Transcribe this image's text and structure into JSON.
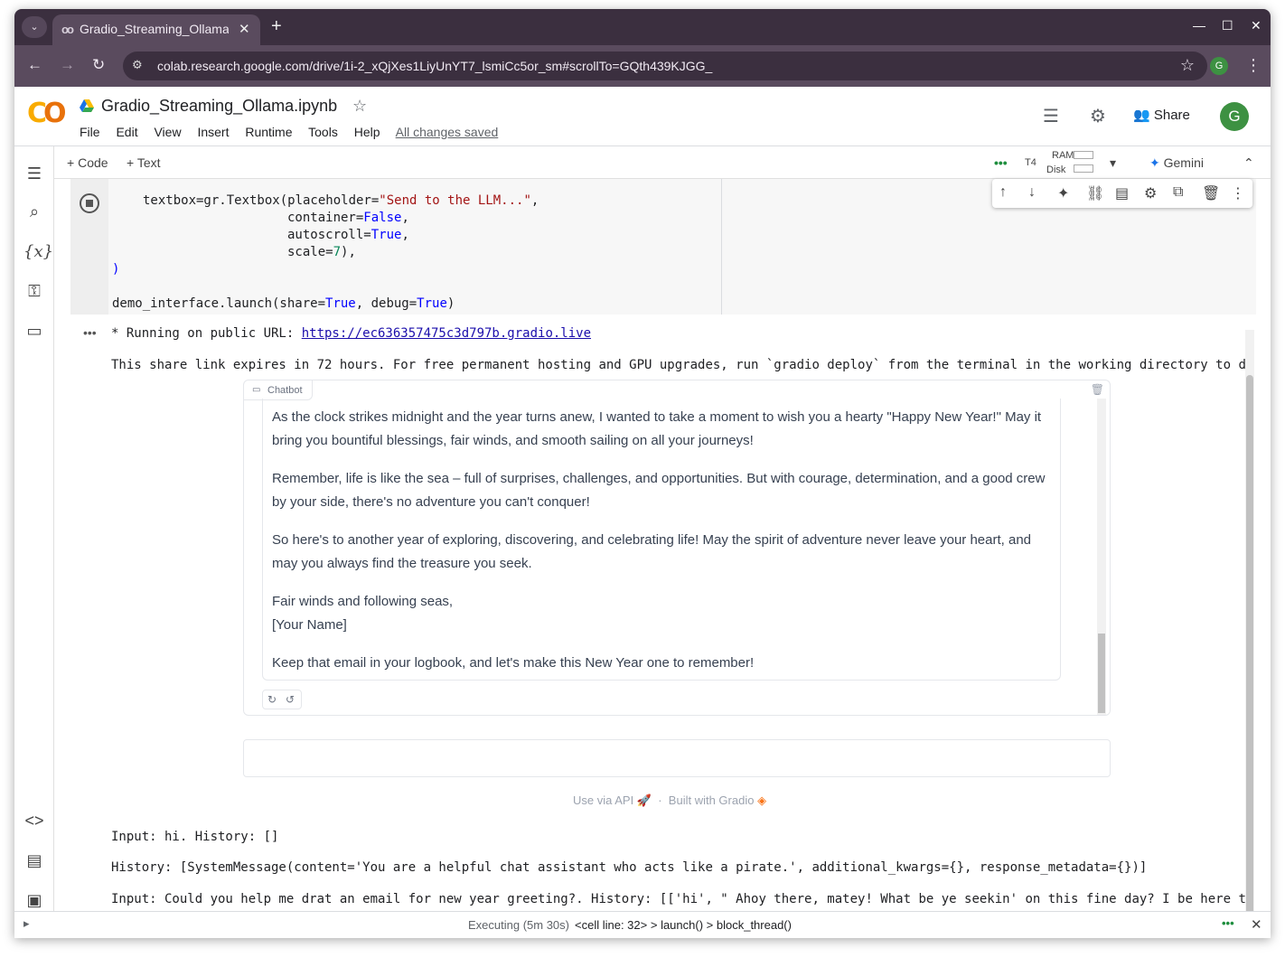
{
  "browser": {
    "tab_title": "Gradio_Streaming_Ollama.ipynb - Colab",
    "url": "colab.research.google.com/drive/1i-2_xQjXes1LiyUnYT7_lsmiCc5or_sm#scrollTo=GQth439KJGG_",
    "profile_initial": "G"
  },
  "colab": {
    "notebook_title": "Gradio_Streaming_Ollama.ipynb",
    "menu": [
      "File",
      "Edit",
      "View",
      "Insert",
      "Runtime",
      "Tools",
      "Help"
    ],
    "save_status": "All changes saved",
    "share_label": "Share",
    "user_initial": "G",
    "add_code_label": "Code",
    "add_text_label": "Text",
    "runtime_type": "T4",
    "ram_label": "RAM",
    "disk_label": "Disk",
    "gemini_label": "Gemini"
  },
  "code_lines": {
    "l1_fn": "textbox=gr.Textbox(placeholder=",
    "l1_str": "\"Send to the LLM...\"",
    "l2_kw": "container=",
    "l2_val": "False",
    "l3_kw": "autoscroll=",
    "l3_val": "True",
    "l4_kw": "scale=",
    "l4_val": "7",
    "l5": ")",
    "l6_fn": "demo_interface.launch(share=",
    "l6_v1": "True",
    "l6_mid": ", debug=",
    "l6_v2": "True"
  },
  "output": {
    "public_url_prefix": "* Running on public URL: ",
    "public_url": "https://ec636357475c3d797b.gradio.live",
    "share_note": "This share link expires in 72 hours. For free permanent hosting and GPU upgrades, run `gradio deploy` from the terminal in the working directory to d",
    "chatbot_label": "Chatbot",
    "messages": [
      "As the clock strikes midnight and the year turns anew, I wanted to take a moment to wish you a hearty \"Happy New Year!\" May it bring you bountiful blessings, fair winds, and smooth sailing on all your journeys!",
      "Remember, life is like the sea – full of surprises, challenges, and opportunities. But with courage, determination, and a good crew by your side, there's no adventure you can't conquer!",
      "So here's to another year of exploring, discovering, and celebrating life! May the spirit of adventure never leave your heart, and may you always find the treasure you seek.",
      "Fair winds and following seas,",
      "[Your Name]",
      "Keep that email in your logbook, and let's make this New Year one to remember!"
    ],
    "use_api": "Use via API",
    "built_with": "Built with Gradio",
    "log1": "Input: hi. History: []",
    "log2": "History: [SystemMessage(content='You are a helpful chat assistant who acts like a pirate.', additional_kwargs={}, response_metadata={})]",
    "log3": "Input: Could you help me drat an email for new year greeting?. History: [['hi', \" Ahoy there, matey! What be ye seekin' on this fine day? I be here t"
  },
  "status": {
    "executing": "Executing (5m 30s)",
    "cell_line": "<cell line: 32>",
    "fn1": "launch()",
    "fn2": "block_thread()"
  }
}
